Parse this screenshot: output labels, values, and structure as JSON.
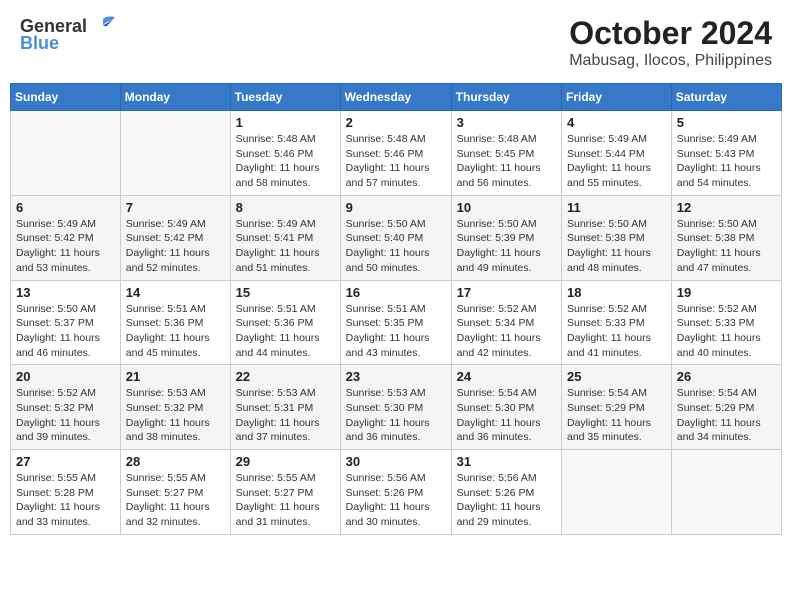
{
  "header": {
    "logo_general": "General",
    "logo_blue": "Blue",
    "month_year": "October 2024",
    "location": "Mabusag, Ilocos, Philippines"
  },
  "weekdays": [
    "Sunday",
    "Monday",
    "Tuesday",
    "Wednesday",
    "Thursday",
    "Friday",
    "Saturday"
  ],
  "weeks": [
    [
      {
        "day": "",
        "info": ""
      },
      {
        "day": "",
        "info": ""
      },
      {
        "day": "1",
        "info": "Sunrise: 5:48 AM\nSunset: 5:46 PM\nDaylight: 11 hours and 58 minutes."
      },
      {
        "day": "2",
        "info": "Sunrise: 5:48 AM\nSunset: 5:46 PM\nDaylight: 11 hours and 57 minutes."
      },
      {
        "day": "3",
        "info": "Sunrise: 5:48 AM\nSunset: 5:45 PM\nDaylight: 11 hours and 56 minutes."
      },
      {
        "day": "4",
        "info": "Sunrise: 5:49 AM\nSunset: 5:44 PM\nDaylight: 11 hours and 55 minutes."
      },
      {
        "day": "5",
        "info": "Sunrise: 5:49 AM\nSunset: 5:43 PM\nDaylight: 11 hours and 54 minutes."
      }
    ],
    [
      {
        "day": "6",
        "info": "Sunrise: 5:49 AM\nSunset: 5:42 PM\nDaylight: 11 hours and 53 minutes."
      },
      {
        "day": "7",
        "info": "Sunrise: 5:49 AM\nSunset: 5:42 PM\nDaylight: 11 hours and 52 minutes."
      },
      {
        "day": "8",
        "info": "Sunrise: 5:49 AM\nSunset: 5:41 PM\nDaylight: 11 hours and 51 minutes."
      },
      {
        "day": "9",
        "info": "Sunrise: 5:50 AM\nSunset: 5:40 PM\nDaylight: 11 hours and 50 minutes."
      },
      {
        "day": "10",
        "info": "Sunrise: 5:50 AM\nSunset: 5:39 PM\nDaylight: 11 hours and 49 minutes."
      },
      {
        "day": "11",
        "info": "Sunrise: 5:50 AM\nSunset: 5:38 PM\nDaylight: 11 hours and 48 minutes."
      },
      {
        "day": "12",
        "info": "Sunrise: 5:50 AM\nSunset: 5:38 PM\nDaylight: 11 hours and 47 minutes."
      }
    ],
    [
      {
        "day": "13",
        "info": "Sunrise: 5:50 AM\nSunset: 5:37 PM\nDaylight: 11 hours and 46 minutes."
      },
      {
        "day": "14",
        "info": "Sunrise: 5:51 AM\nSunset: 5:36 PM\nDaylight: 11 hours and 45 minutes."
      },
      {
        "day": "15",
        "info": "Sunrise: 5:51 AM\nSunset: 5:36 PM\nDaylight: 11 hours and 44 minutes."
      },
      {
        "day": "16",
        "info": "Sunrise: 5:51 AM\nSunset: 5:35 PM\nDaylight: 11 hours and 43 minutes."
      },
      {
        "day": "17",
        "info": "Sunrise: 5:52 AM\nSunset: 5:34 PM\nDaylight: 11 hours and 42 minutes."
      },
      {
        "day": "18",
        "info": "Sunrise: 5:52 AM\nSunset: 5:33 PM\nDaylight: 11 hours and 41 minutes."
      },
      {
        "day": "19",
        "info": "Sunrise: 5:52 AM\nSunset: 5:33 PM\nDaylight: 11 hours and 40 minutes."
      }
    ],
    [
      {
        "day": "20",
        "info": "Sunrise: 5:52 AM\nSunset: 5:32 PM\nDaylight: 11 hours and 39 minutes."
      },
      {
        "day": "21",
        "info": "Sunrise: 5:53 AM\nSunset: 5:32 PM\nDaylight: 11 hours and 38 minutes."
      },
      {
        "day": "22",
        "info": "Sunrise: 5:53 AM\nSunset: 5:31 PM\nDaylight: 11 hours and 37 minutes."
      },
      {
        "day": "23",
        "info": "Sunrise: 5:53 AM\nSunset: 5:30 PM\nDaylight: 11 hours and 36 minutes."
      },
      {
        "day": "24",
        "info": "Sunrise: 5:54 AM\nSunset: 5:30 PM\nDaylight: 11 hours and 36 minutes."
      },
      {
        "day": "25",
        "info": "Sunrise: 5:54 AM\nSunset: 5:29 PM\nDaylight: 11 hours and 35 minutes."
      },
      {
        "day": "26",
        "info": "Sunrise: 5:54 AM\nSunset: 5:29 PM\nDaylight: 11 hours and 34 minutes."
      }
    ],
    [
      {
        "day": "27",
        "info": "Sunrise: 5:55 AM\nSunset: 5:28 PM\nDaylight: 11 hours and 33 minutes."
      },
      {
        "day": "28",
        "info": "Sunrise: 5:55 AM\nSunset: 5:27 PM\nDaylight: 11 hours and 32 minutes."
      },
      {
        "day": "29",
        "info": "Sunrise: 5:55 AM\nSunset: 5:27 PM\nDaylight: 11 hours and 31 minutes."
      },
      {
        "day": "30",
        "info": "Sunrise: 5:56 AM\nSunset: 5:26 PM\nDaylight: 11 hours and 30 minutes."
      },
      {
        "day": "31",
        "info": "Sunrise: 5:56 AM\nSunset: 5:26 PM\nDaylight: 11 hours and 29 minutes."
      },
      {
        "day": "",
        "info": ""
      },
      {
        "day": "",
        "info": ""
      }
    ]
  ]
}
